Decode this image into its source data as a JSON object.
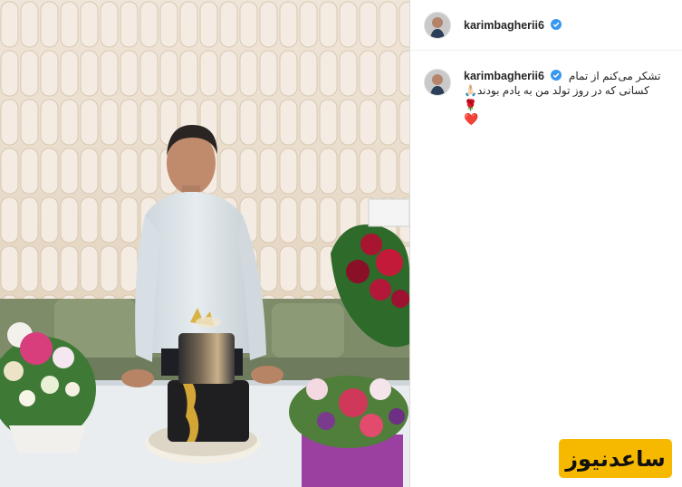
{
  "post": {
    "username": "karimbagherii6",
    "verified": true,
    "caption": {
      "username": "karimbagherii6",
      "line1": "تشکر می‌کنم از تمام",
      "line2": "کسانی که در روز تولد من به یادم بودند",
      "emoji_pray": "🙏🏻",
      "emoji_rose": "🌹",
      "emoji_heart": "❤️"
    }
  },
  "watermark": {
    "text": "ساعدنیوز"
  },
  "colors": {
    "verified_blue": "#3897f0",
    "watermark_bg": "#f7b800"
  }
}
